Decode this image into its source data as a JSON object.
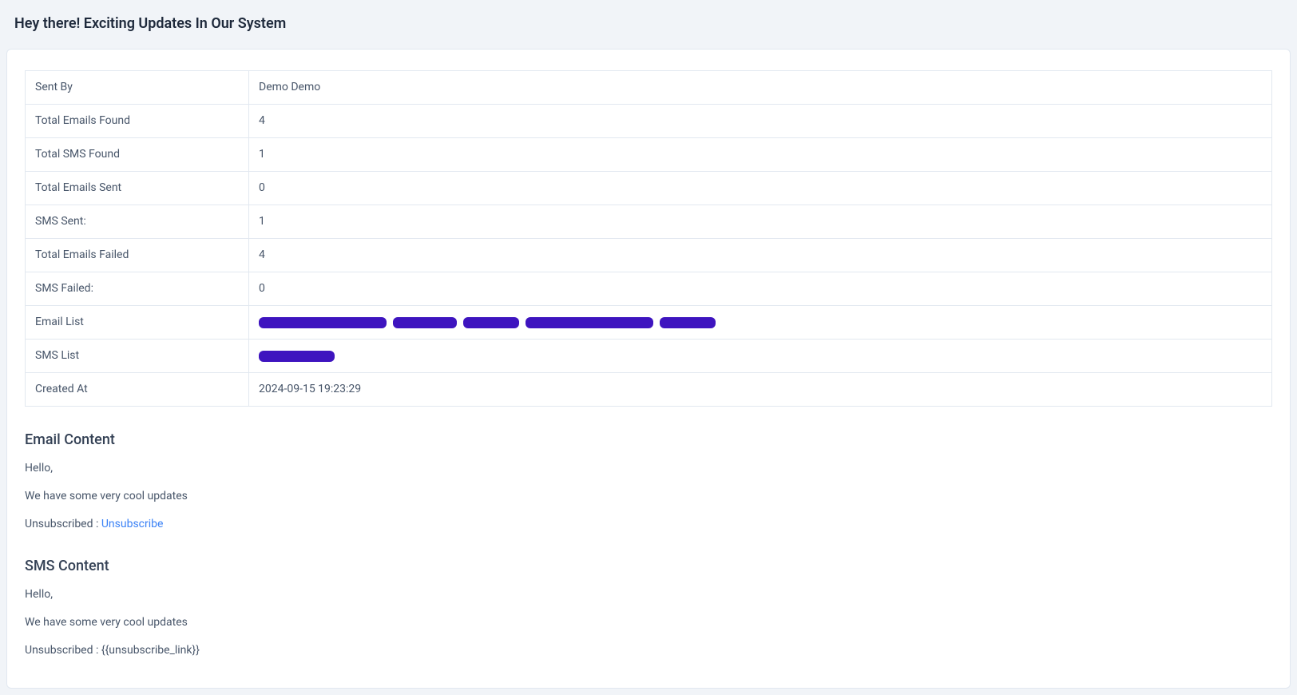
{
  "page_title": "Hey there! Exciting Updates In Our System",
  "table": {
    "rows": [
      {
        "label": "Sent By",
        "value": "Demo Demo"
      },
      {
        "label": "Total Emails Found",
        "value": "4"
      },
      {
        "label": "Total SMS Found",
        "value": "1"
      },
      {
        "label": "Total Emails Sent",
        "value": "0"
      },
      {
        "label": "SMS Sent:",
        "value": "1"
      },
      {
        "label": "Total Emails Failed",
        "value": "4"
      },
      {
        "label": "SMS Failed:",
        "value": "0"
      },
      {
        "label": "Email List",
        "value": "",
        "redacted": "email"
      },
      {
        "label": "SMS List",
        "value": "",
        "redacted": "sms"
      },
      {
        "label": "Created At",
        "value": "2024-09-15 19:23:29"
      }
    ]
  },
  "email_content": {
    "heading": "Email Content",
    "line1": "Hello,",
    "line2": "We have some very cool updates",
    "unsub_prefix": "Unsubscribed : ",
    "unsub_link_text": "Unsubscribe"
  },
  "sms_content": {
    "heading": "SMS Content",
    "line1": "Hello,",
    "line2": "We have some very cool updates",
    "unsub_line": "Unsubscribed : {{unsubscribe_link}}"
  }
}
